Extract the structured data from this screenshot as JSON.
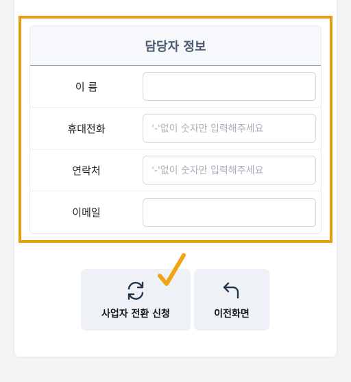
{
  "section": {
    "title": "담당자 정보"
  },
  "fields": [
    {
      "label": "이 름",
      "placeholder": ""
    },
    {
      "label": "휴대전화",
      "placeholder": "'-'없이 숫자만 입력해주세요"
    },
    {
      "label": "연락처",
      "placeholder": "'-'없이 숫자만 입력해주세요"
    },
    {
      "label": "이메일",
      "placeholder": ""
    }
  ],
  "buttons": {
    "convert": {
      "label": "사업자 전환 신청",
      "icon": "refresh-icon"
    },
    "back": {
      "label": "이전화면",
      "icon": "return-arrow-icon"
    }
  },
  "colors": {
    "highlight": "#e89b0c",
    "checkmark": "#f0a412",
    "header_bg": "#f6f8fb",
    "button_bg": "#eef2f7"
  }
}
